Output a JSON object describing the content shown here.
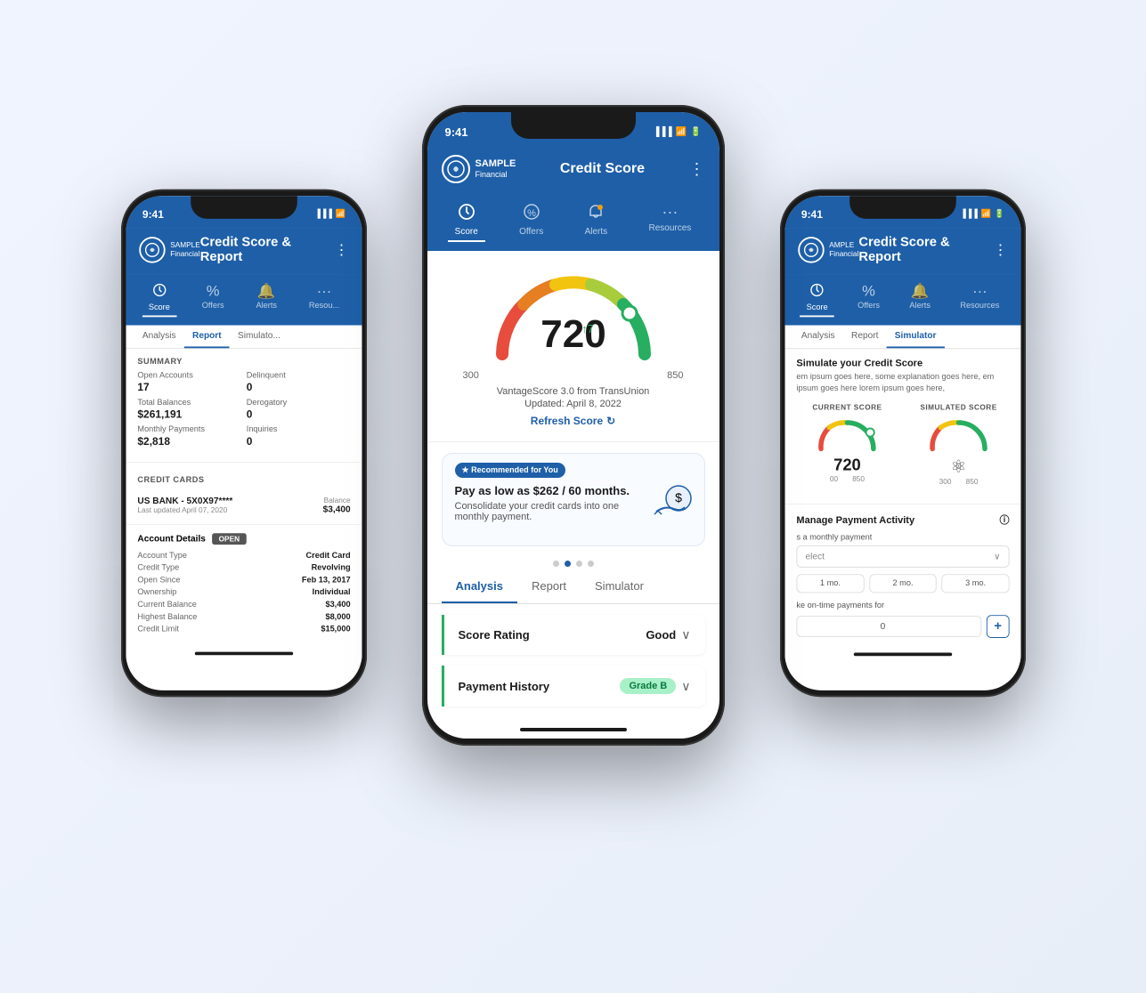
{
  "app": {
    "name": "SAMPLE Financial",
    "name_sub": "Financial"
  },
  "phones": {
    "left": {
      "time": "9:41",
      "header_title": "Credit Score & Report",
      "tabs": [
        {
          "label": "Score",
          "icon": "⏱",
          "active": true
        },
        {
          "label": "Offers",
          "icon": "%"
        },
        {
          "label": "Alerts",
          "icon": "🔔"
        },
        {
          "label": "Resou...",
          "icon": "···"
        }
      ],
      "sub_tabs": [
        {
          "label": "Analysis"
        },
        {
          "label": "Report",
          "active": true
        },
        {
          "label": "Simulato..."
        }
      ],
      "summary_title": "SUMMARY",
      "summary": {
        "open_accounts_label": "Open Accounts",
        "open_accounts_value": "17",
        "delinquent_label": "Delinquent",
        "delinquent_value": "0",
        "total_balances_label": "Total Balances",
        "total_balances_value": "$261,191",
        "derogatory_label": "Derogatory",
        "derogatory_value": "0",
        "monthly_payments_label": "Monthly Payments",
        "monthly_payments_value": "$2,818",
        "inquiries_label": "Inquiries",
        "inquiries_value": "0"
      },
      "credit_cards_title": "CREDIT CARDS",
      "card": {
        "name": "US BANK - 5X0X97****",
        "last_updated": "Last updated April 07, 2020",
        "balance_label": "Balance",
        "balance_value": "$3,400"
      },
      "account_details_title": "Account Details",
      "account_status": "OPEN",
      "details": [
        {
          "label": "Account Type",
          "value": "Credit Card"
        },
        {
          "label": "Credit Type",
          "value": "Revolving"
        },
        {
          "label": "Open Since",
          "value": "Feb 13, 2017"
        },
        {
          "label": "Ownership",
          "value": "Individual"
        },
        {
          "label": "Current Balance",
          "value": "$3,400"
        },
        {
          "label": "Highest Balance",
          "value": "$8,000"
        },
        {
          "label": "Credit Limit",
          "value": "$15,000"
        }
      ]
    },
    "center": {
      "time": "9:41",
      "header_title": "Credit Score",
      "tabs": [
        {
          "label": "Score",
          "active": true
        },
        {
          "label": "Offers"
        },
        {
          "label": "Alerts"
        },
        {
          "label": "Resources"
        }
      ],
      "score": {
        "number": "720",
        "arrow": "↑7",
        "min": "300",
        "max": "850",
        "source": "VantageScore 3.0 from TransUnion",
        "updated": "Updated: April 8, 2022",
        "refresh_label": "Refresh Score"
      },
      "offer": {
        "badge": "★ Recommended for You",
        "title": "Pay as low as $262 / 60 months.",
        "desc": "Consolidate your credit cards into one monthly payment."
      },
      "sub_tabs": [
        {
          "label": "Analysis",
          "active": true
        },
        {
          "label": "Report"
        },
        {
          "label": "Simulator"
        }
      ],
      "analysis": [
        {
          "title": "Score Rating",
          "value": "Good",
          "type": "value"
        },
        {
          "title": "Payment History",
          "value": "Grade B",
          "type": "grade"
        }
      ]
    },
    "right": {
      "time": "9:41",
      "header_title": "Credit Score & Report",
      "tabs": [
        {
          "label": "Score",
          "active": true
        },
        {
          "label": "Offers"
        },
        {
          "label": "Alerts"
        },
        {
          "label": "Resources"
        }
      ],
      "sub_tabs": [
        {
          "label": "Analysis"
        },
        {
          "label": "Report"
        },
        {
          "label": "Simulator",
          "active": true
        }
      ],
      "simulator_title": "Simulate your Credit Score",
      "simulator_desc": "em ipsum goes here, some explanation goes here, em ipsum goes here lorem ipsum goes here,",
      "current_score_label": "CURRENT SCORE",
      "simulated_score_label": "SIMULATED SCORE",
      "current_score": "720",
      "current_score_range_left": "00",
      "current_score_range_right": "850",
      "simulated_score_icon": "⚛",
      "simulated_range_left": "300",
      "simulated_range_right": "850",
      "manage_payment_title": "Manage Payment Activity",
      "payment_label": "s a monthly payment",
      "select_placeholder": "elect",
      "months": [
        "1 mo.",
        "2 mo.",
        "3 mo."
      ],
      "on_time_label": "ke on-time payments for",
      "input_value": "0",
      "plus_label": "+"
    }
  }
}
